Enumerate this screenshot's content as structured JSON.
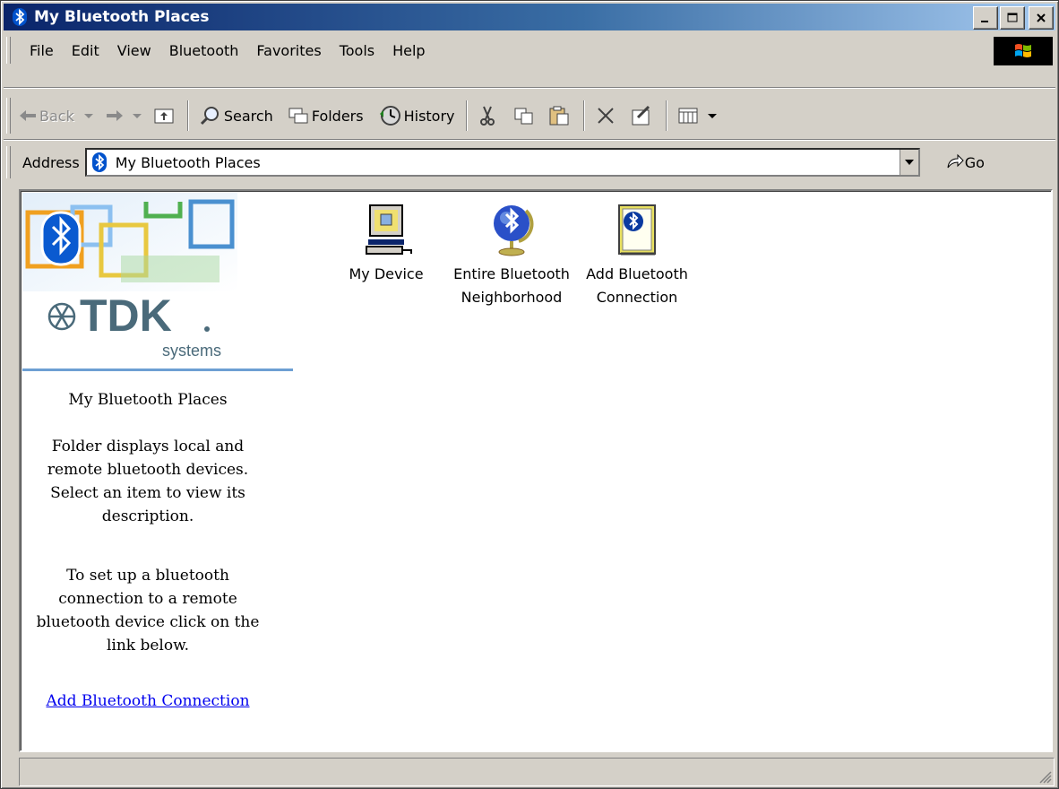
{
  "window": {
    "title": "My Bluetooth Places"
  },
  "menu": {
    "items": [
      "File",
      "Edit",
      "View",
      "Bluetooth",
      "Favorites",
      "Tools",
      "Help"
    ]
  },
  "toolbar": {
    "back": "Back",
    "search": "Search",
    "folders": "Folders",
    "history": "History"
  },
  "address": {
    "label": "Address",
    "value": "My Bluetooth Places",
    "go": "Go"
  },
  "webview": {
    "brand": "TDK",
    "brand_sub": "systems",
    "title": "My Bluetooth Places",
    "desc1": "Folder displays local and remote bluetooth devices. Select an item to view its description.",
    "desc2": "To set up a bluetooth connection to a remote bluetooth device click on the link below.",
    "link": "Add Bluetooth Connection"
  },
  "icons": [
    {
      "label": "My Device",
      "icon": "computer-icon"
    },
    {
      "label": "Entire Bluetooth Neighborhood",
      "icon": "bluetooth-globe-icon"
    },
    {
      "label": "Add Bluetooth Connection",
      "icon": "add-connection-icon"
    }
  ],
  "colors": {
    "titlebar": "#0a246a",
    "accent": "#0052cc",
    "link": "#0000ee"
  }
}
